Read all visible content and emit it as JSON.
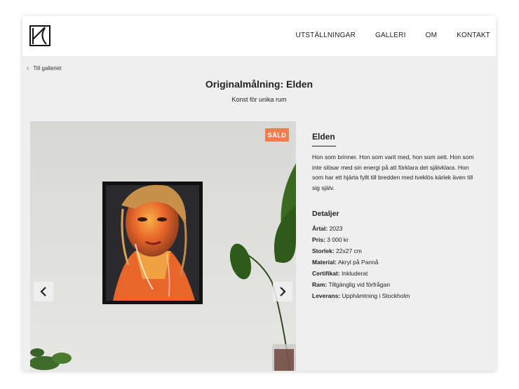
{
  "nav": {
    "items": [
      {
        "label": "UTSTÄLLNINGAR"
      },
      {
        "label": "GALLERI"
      },
      {
        "label": "OM"
      },
      {
        "label": "KONTAKT"
      }
    ]
  },
  "breadcrumb": {
    "back_label": "Till galleriet"
  },
  "page": {
    "title": "Originalmålning: Elden",
    "subtitle": "Konst för unika rum"
  },
  "artwork": {
    "badge": "SÅLD",
    "name": "Elden",
    "description": "Hon som brinner. Hon som varit med, hon som sett. Hon som inte slösar med sin energi på att förklara det självklara. Hon som har ett hjärta fyllt till bredden med tveklös kärlek även till sig själv.",
    "details_heading": "Detaljer",
    "specs": [
      {
        "label": "Årtal:",
        "value": "2023"
      },
      {
        "label": "Pris:",
        "value": "3 000 kr"
      },
      {
        "label": "Storlek:",
        "value": "22x27 cm"
      },
      {
        "label": "Material:",
        "value": "Akryl på Pannå"
      },
      {
        "label": "Certifikat:",
        "value": "Inkluderat"
      },
      {
        "label": "Ram:",
        "value": "Tillgänglig vid förfrågan"
      },
      {
        "label": "Leverans:",
        "value": "Upphämtning i Stockholm"
      }
    ]
  },
  "colors": {
    "badge": "#f07c50",
    "background": "#efefef",
    "text": "#222222"
  }
}
